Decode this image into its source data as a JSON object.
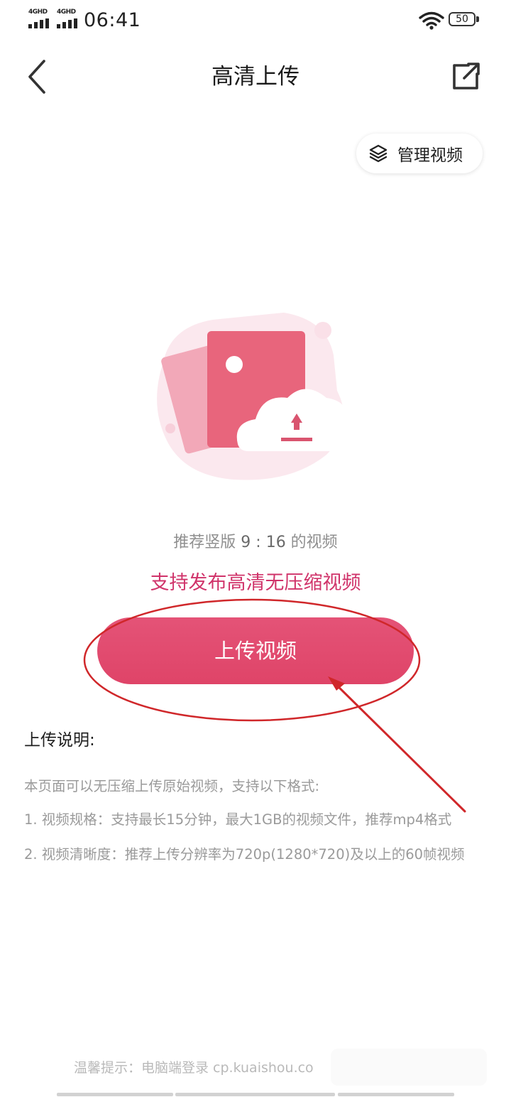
{
  "status_bar": {
    "network_labels": [
      "4GHD",
      "4GHD"
    ],
    "time": "06:41",
    "battery": "50"
  },
  "nav": {
    "title": "高清上传"
  },
  "manage_button": {
    "label": "管理视频"
  },
  "hints": {
    "ratio_prefix": "推荐竖版 ",
    "ratio_value": "9 : 16",
    "ratio_suffix": " 的视频",
    "hd_support": "支持发布高清无压缩视频"
  },
  "upload_button": {
    "label": "上传视频"
  },
  "instructions": {
    "title": "上传说明:",
    "lines": [
      "本页面可以无压缩上传原始视频，支持以下格式:",
      "1. 视频规格：支持最长15分钟，最大1GB的视频文件，推荐mp4格式",
      "2. 视频清晰度：推荐上传分辨率为720p(1280*720)及以上的60帧视频"
    ]
  },
  "footer": {
    "tip": "温馨提示：电脑端登录 cp.kuaishou.co"
  },
  "colors": {
    "accent": "#df4468",
    "accent_text": "#d0336a",
    "annotation": "#d0272a"
  }
}
